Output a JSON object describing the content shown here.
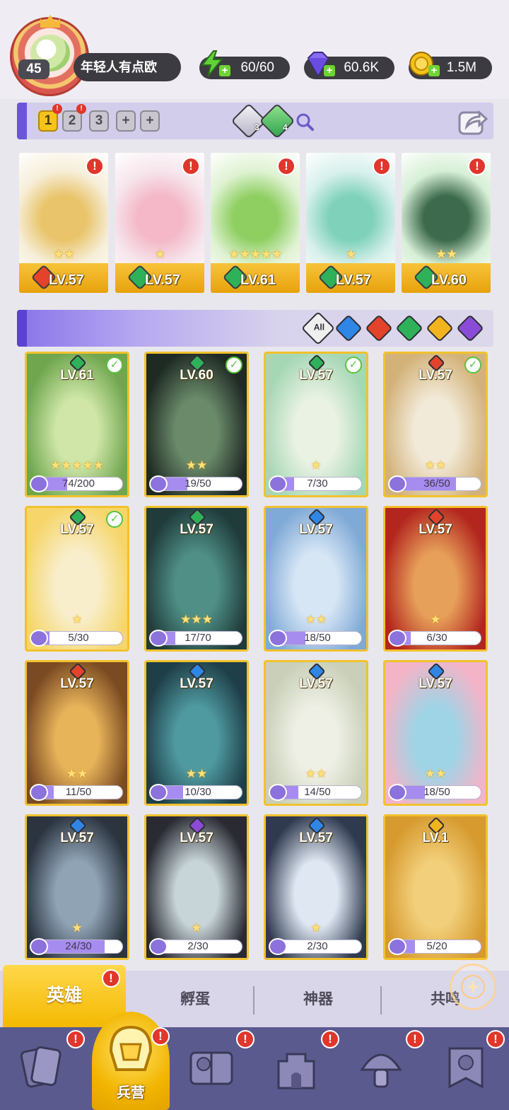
{
  "player": {
    "level": "45",
    "name": "年轻人有点欧"
  },
  "resources": {
    "energy": {
      "value": "60/60",
      "icon": "lightning-icon",
      "color": "#5fd23a"
    },
    "gems": {
      "value": "60.6K",
      "icon": "diamond-icon",
      "color": "#8a6cf0"
    },
    "coins": {
      "value": "1.5M",
      "icon": "coin-icon",
      "color": "#f3c21a"
    }
  },
  "team_tabs": [
    {
      "label": "1",
      "active": true,
      "alert": true
    },
    {
      "label": "2",
      "active": false,
      "alert": true
    },
    {
      "label": "3",
      "active": false,
      "alert": false
    },
    {
      "label": "+",
      "active": false,
      "alert": false
    },
    {
      "label": "+",
      "active": false,
      "alert": false
    }
  ],
  "team_gem_badges": [
    {
      "count": "3"
    },
    {
      "count": "4"
    }
  ],
  "team_heroes": [
    {
      "level": "LV.57",
      "element": "fire",
      "stars": "★★",
      "alert": "!",
      "art_color": "#f6eed8",
      "art_accent": "#e9c46a"
    },
    {
      "level": "LV.57",
      "element": "nature",
      "stars": "★",
      "alert": "!",
      "art_color": "#f6e5ec",
      "art_accent": "#f4b8c8"
    },
    {
      "level": "LV.61",
      "element": "nature",
      "stars": "★★★★★",
      "alert": "!",
      "art_color": "#dff2d2",
      "art_accent": "#8fcf62"
    },
    {
      "level": "LV.57",
      "element": "nature",
      "stars": "★",
      "alert": "!",
      "art_color": "#d8f0ec",
      "art_accent": "#7fd2b9"
    },
    {
      "level": "LV.60",
      "element": "nature",
      "stars": "★★",
      "alert": "!",
      "art_color": "#d6efd6",
      "art_accent": "#3d6a4c"
    }
  ],
  "filters": {
    "all_label": "All",
    "elements": [
      {
        "name": "water",
        "color": "#2f86e5"
      },
      {
        "name": "fire",
        "color": "#e2432a"
      },
      {
        "name": "nature",
        "color": "#2fb15a"
      },
      {
        "name": "light",
        "color": "#f2b41c"
      },
      {
        "name": "dark",
        "color": "#8a4cd6"
      }
    ]
  },
  "heroes": [
    {
      "level": "LV.61",
      "element": "nature",
      "equipped": true,
      "stars": "★★★★★",
      "progress": "74/200",
      "fraction": 0.37,
      "art": "#cfe6a8",
      "art2": "#6fa64e"
    },
    {
      "level": "LV.60",
      "element": "nature",
      "equipped": true,
      "stars": "★★",
      "progress": "19/50",
      "fraction": 0.38,
      "art": "#6a8a6a",
      "art2": "#1f2a24"
    },
    {
      "level": "LV.57",
      "element": "nature",
      "equipped": true,
      "stars": "★",
      "progress": "7/30",
      "fraction": 0.23,
      "art": "#eaf2e4",
      "art2": "#a6d7b5"
    },
    {
      "level": "LV.57",
      "element": "fire",
      "equipped": true,
      "stars": "★★",
      "progress": "36/50",
      "fraction": 0.72,
      "art": "#f2ead8",
      "art2": "#d3b27a"
    },
    {
      "level": "LV.57",
      "element": "nature",
      "equipped": true,
      "stars": "★",
      "progress": "5/30",
      "fraction": 0.17,
      "art": "#f8eecb",
      "art2": "#f6d66b"
    },
    {
      "level": "LV.57",
      "element": "nature",
      "equipped": false,
      "stars": "★★★",
      "progress": "17/70",
      "fraction": 0.24,
      "art": "#4f8f86",
      "art2": "#1f3b3a"
    },
    {
      "level": "LV.57",
      "element": "water",
      "equipped": false,
      "stars": "★★",
      "progress": "18/50",
      "fraction": 0.36,
      "art": "#d6e6f5",
      "art2": "#7fa9d6"
    },
    {
      "level": "LV.57",
      "element": "fire",
      "equipped": false,
      "stars": "★",
      "progress": "6/30",
      "fraction": 0.2,
      "art": "#e7a05a",
      "art2": "#b3261e"
    },
    {
      "level": "LV.57",
      "element": "fire",
      "equipped": false,
      "stars": "★★",
      "progress": "11/50",
      "fraction": 0.22,
      "art": "#e8b45a",
      "art2": "#7a4a22"
    },
    {
      "level": "LV.57",
      "element": "water",
      "equipped": false,
      "stars": "★★",
      "progress": "10/30",
      "fraction": 0.33,
      "art": "#4f9aa0",
      "art2": "#1f3f48"
    },
    {
      "level": "LV.57",
      "element": "water",
      "equipped": false,
      "stars": "★★",
      "progress": "14/50",
      "fraction": 0.28,
      "art": "#eef0e6",
      "art2": "#c9cfb8"
    },
    {
      "level": "LV.57",
      "element": "water",
      "equipped": false,
      "stars": "★★",
      "progress": "18/50",
      "fraction": 0.36,
      "art": "#9fd4e6",
      "art2": "#f3b4c8"
    },
    {
      "level": "LV.57",
      "element": "water",
      "equipped": false,
      "stars": "★",
      "progress": "24/30",
      "fraction": 0.8,
      "art": "#8fa3b5",
      "art2": "#2c3440"
    },
    {
      "level": "LV.57",
      "element": "dark",
      "equipped": false,
      "stars": "★",
      "progress": "2/30",
      "fraction": 0.07,
      "art": "#c7d4d8",
      "art2": "#2a2a33"
    },
    {
      "level": "LV.57",
      "element": "water",
      "equipped": false,
      "stars": "★",
      "progress": "2/30",
      "fraction": 0.07,
      "art": "#dfe7f2",
      "art2": "#2f3a4f"
    },
    {
      "level": "LV.1",
      "element": "light",
      "equipped": false,
      "stars": "",
      "progress": "5/20",
      "fraction": 0.25,
      "art": "#f2cf7a",
      "art2": "#d69a2f"
    }
  ],
  "subtabs": [
    {
      "label": "英雄",
      "active": true,
      "alert": true
    },
    {
      "label": "孵蛋",
      "active": false,
      "alert": false
    },
    {
      "label": "神器",
      "active": false,
      "alert": false
    },
    {
      "label": "共鸣",
      "active": false,
      "alert": false
    }
  ],
  "nav": [
    {
      "name": "cards",
      "icon": "cards-icon",
      "alert": true
    },
    {
      "name": "barracks",
      "label": "兵营",
      "icon": "barracks-icon",
      "alert": true,
      "active": true
    },
    {
      "name": "book",
      "icon": "book-icon",
      "alert": true
    },
    {
      "name": "castle",
      "icon": "castle-icon",
      "alert": true
    },
    {
      "name": "mushroom",
      "icon": "mushroom-icon",
      "alert": true
    },
    {
      "name": "guild",
      "icon": "guild-banner-icon",
      "alert": true
    }
  ],
  "element_colors": {
    "fire": "#e2432a",
    "nature": "#2fb15a",
    "water": "#2f86e5",
    "light": "#f2b41c",
    "dark": "#8a4cd6"
  },
  "alert_mark": "!"
}
